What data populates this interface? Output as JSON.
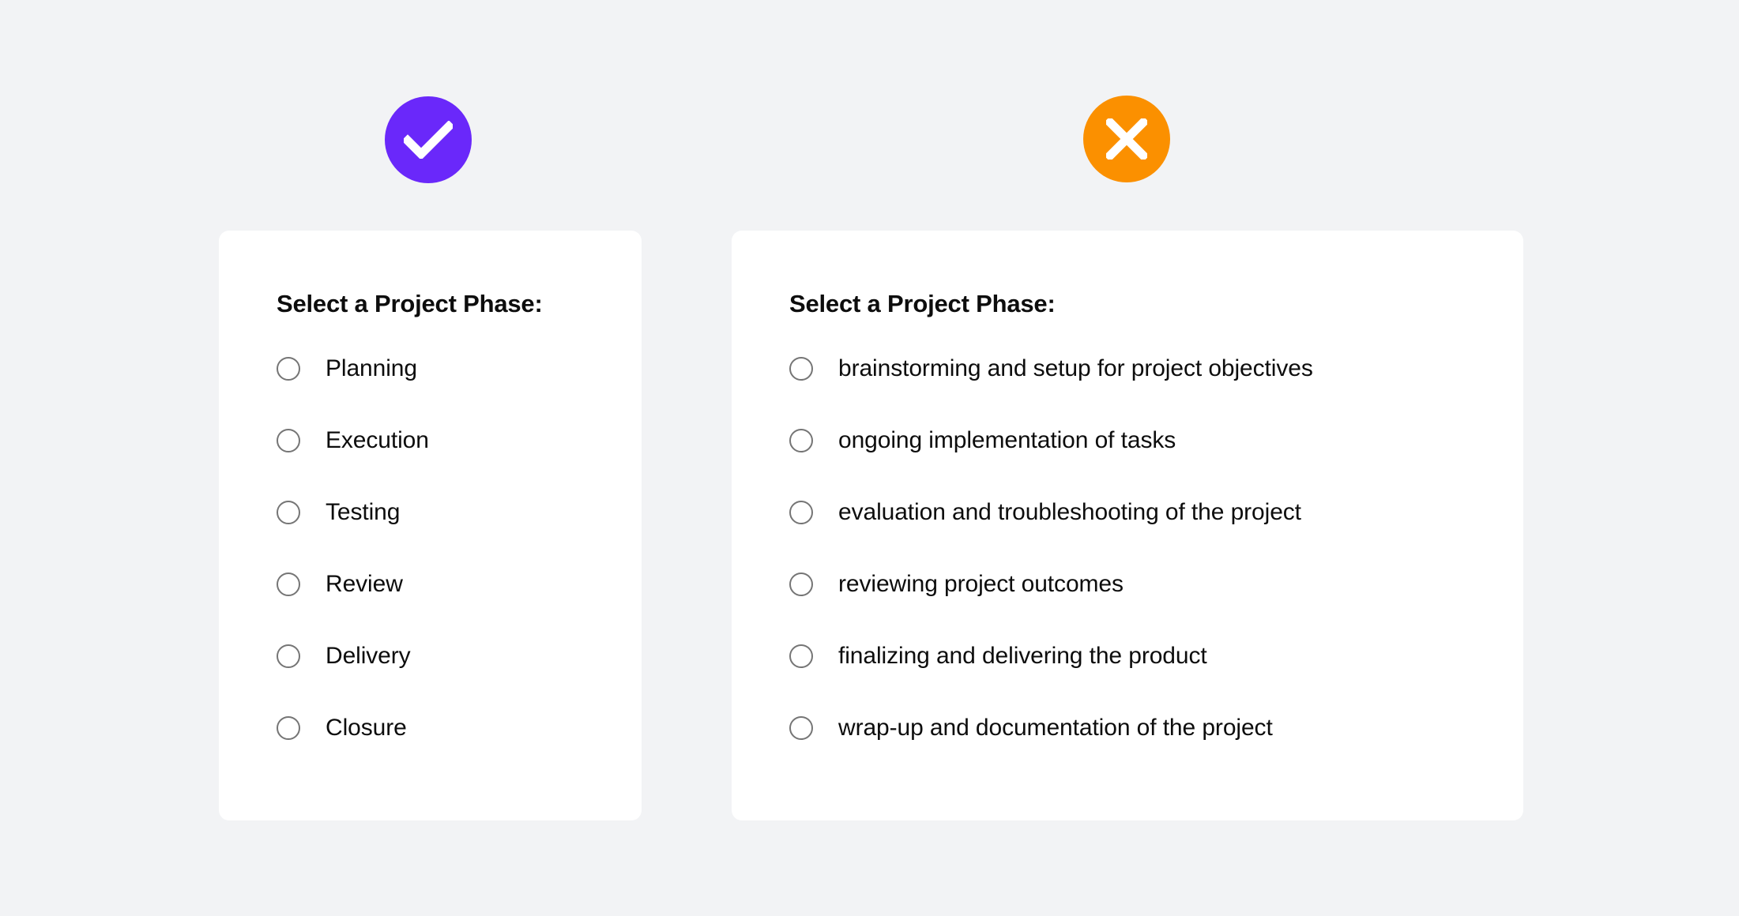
{
  "background_color": "#f2f3f5",
  "panels": [
    {
      "id": "good-example",
      "status_icon": {
        "name": "check-circle-icon",
        "glyph": "check",
        "color": "#6a28fa",
        "meaning": "correct example"
      },
      "card": {
        "background": "#ffffff",
        "heading": "Select a Project Phase:",
        "options": [
          "Planning",
          "Execution",
          "Testing",
          "Review",
          "Delivery",
          "Closure"
        ]
      }
    },
    {
      "id": "bad-example",
      "status_icon": {
        "name": "x-circle-icon",
        "glyph": "cross",
        "color": "#fb9000",
        "meaning": "incorrect example"
      },
      "card": {
        "background": "#ffffff",
        "heading": "Select a Project Phase:",
        "options": [
          "brainstorming and setup for project objectives",
          "ongoing implementation of tasks",
          "evaluation and troubleshooting of the project",
          "reviewing project outcomes",
          "finalizing and delivering the product",
          "wrap-up and documentation of the project"
        ]
      }
    }
  ],
  "radio": {
    "border_color": "#757575",
    "selected_index": -1
  }
}
